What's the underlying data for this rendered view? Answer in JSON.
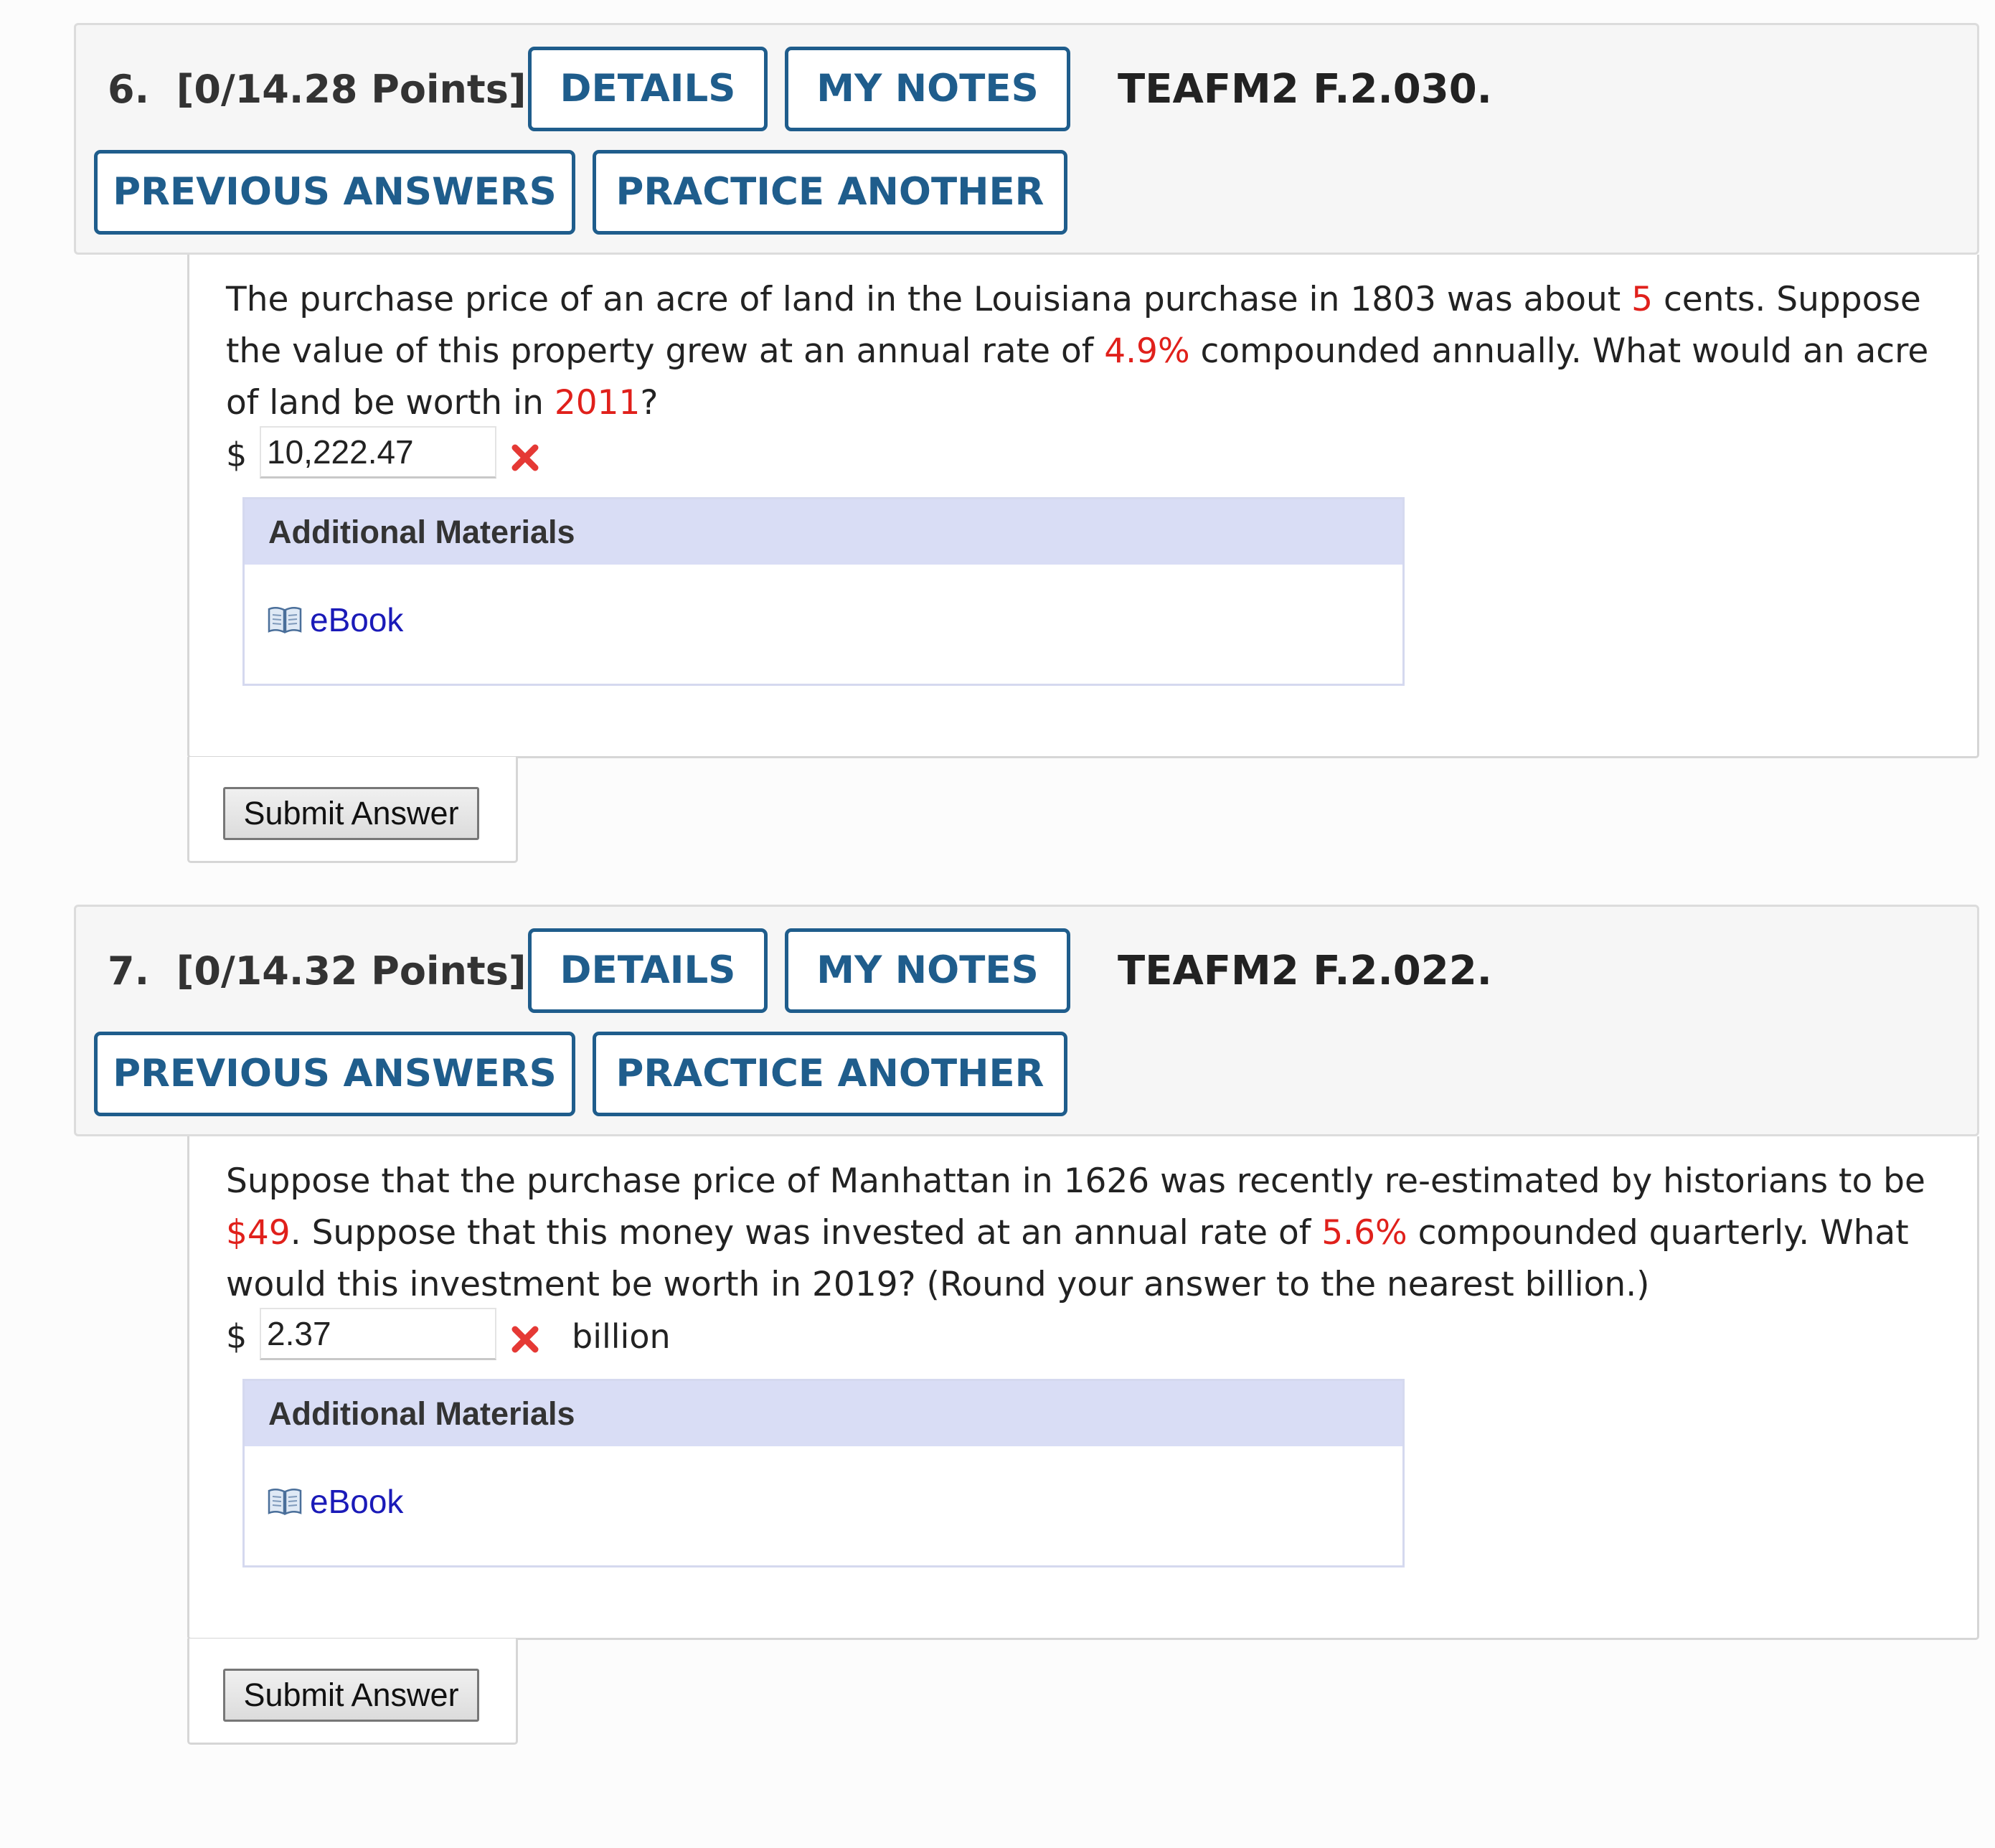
{
  "questions": [
    {
      "number_label": "6.",
      "points": "[0/14.28 Points]",
      "buttons": {
        "details": "DETAILS",
        "my_notes": "MY NOTES",
        "previous_answers": "PREVIOUS ANSWERS",
        "practice_another": "PRACTICE ANOTHER"
      },
      "code": "TEAFM2 F.2.030.",
      "prompt_parts": [
        {
          "text": "The purchase price of an acre of land in the Louisiana purchase in 1803 was about ",
          "highlight": false
        },
        {
          "text": "5",
          "highlight": true
        },
        {
          "text": " cents. Suppose the value of this property grew at an annual rate of ",
          "highlight": false
        },
        {
          "text": "4.9%",
          "highlight": true
        },
        {
          "text": " compounded annually. What would an acre of land be worth in ",
          "highlight": false
        },
        {
          "text": "2011",
          "highlight": true
        },
        {
          "text": "?",
          "highlight": false
        }
      ],
      "answer": {
        "currency": "$",
        "value": "10,222.47",
        "status": "incorrect",
        "unit": ""
      },
      "materials": {
        "heading": "Additional Materials",
        "links": [
          {
            "label": "eBook",
            "icon": "book-icon"
          }
        ]
      },
      "submit_label": "Submit Answer"
    },
    {
      "number_label": "7.",
      "points": "[0/14.32 Points]",
      "buttons": {
        "details": "DETAILS",
        "my_notes": "MY NOTES",
        "previous_answers": "PREVIOUS ANSWERS",
        "practice_another": "PRACTICE ANOTHER"
      },
      "code": "TEAFM2 F.2.022.",
      "prompt_parts": [
        {
          "text": "Suppose that the purchase price of Manhattan in 1626 was recently re-estimated by historians to be ",
          "highlight": false
        },
        {
          "text": "$49",
          "highlight": true
        },
        {
          "text": ". Suppose that this money was invested at an annual rate of ",
          "highlight": false
        },
        {
          "text": "5.6%",
          "highlight": true
        },
        {
          "text": " compounded quarterly. What would this investment be worth in 2019? (Round your answer to the nearest billion.)",
          "highlight": false
        }
      ],
      "answer": {
        "currency": "$",
        "value": "2.37",
        "status": "incorrect",
        "unit": "billion"
      },
      "materials": {
        "heading": "Additional Materials",
        "links": [
          {
            "label": "eBook",
            "icon": "book-icon"
          }
        ]
      },
      "submit_label": "Submit Answer"
    }
  ],
  "colors": {
    "button_text": "#1f5d8c",
    "highlight": "#e0201b",
    "incorrect_mark": "#e53935",
    "materials_header": "#d9ddf5",
    "link": "#1a1ab8"
  },
  "icons": {
    "incorrect": "close-icon",
    "ebook": "book-icon"
  }
}
